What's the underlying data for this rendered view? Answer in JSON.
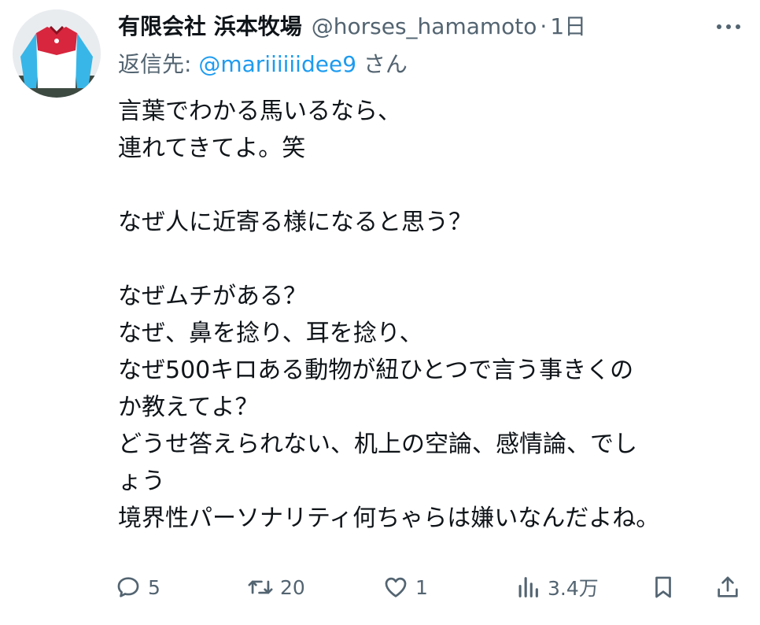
{
  "tweet": {
    "display_name": "有限会社 浜本牧場",
    "handle": "@horses_hamamoto",
    "separator": "·",
    "time": "1日",
    "reply_to": {
      "prefix": "返信先: ",
      "mention": "@mariiiiiidee9",
      "suffix": " さん"
    },
    "body_lines": [
      "言葉でわかる馬いるなら、",
      "連れてきてよ。笑",
      "",
      "なぜ人に近寄る様になると思う？",
      "",
      "なぜムチがある？",
      "なぜ、鼻を捻り、耳を捻り、",
      "なぜ500キロある動物が紐ひとつで言う事きくの",
      "か教えてよ？",
      "どうせ答えられない、机上の空論、感情論、でし",
      "ょう",
      "境界性パーソナリティ何ちゃらは嫌いなんだよね。"
    ],
    "actions": {
      "reply_icon": "reply-icon",
      "reply_count": "5",
      "retweet_icon": "retweet-icon",
      "retweet_count": "20",
      "like_icon": "heart-icon",
      "like_count": "1",
      "views_icon": "views-icon",
      "views_count": "3.4万",
      "bookmark_icon": "bookmark-icon",
      "share_icon": "share-icon"
    }
  },
  "colors": {
    "text": "#0f1419",
    "secondary": "#536471",
    "link": "#1d9bf0",
    "jersey_red": "#d7263d",
    "jersey_sleeve": "#38b6e8"
  }
}
